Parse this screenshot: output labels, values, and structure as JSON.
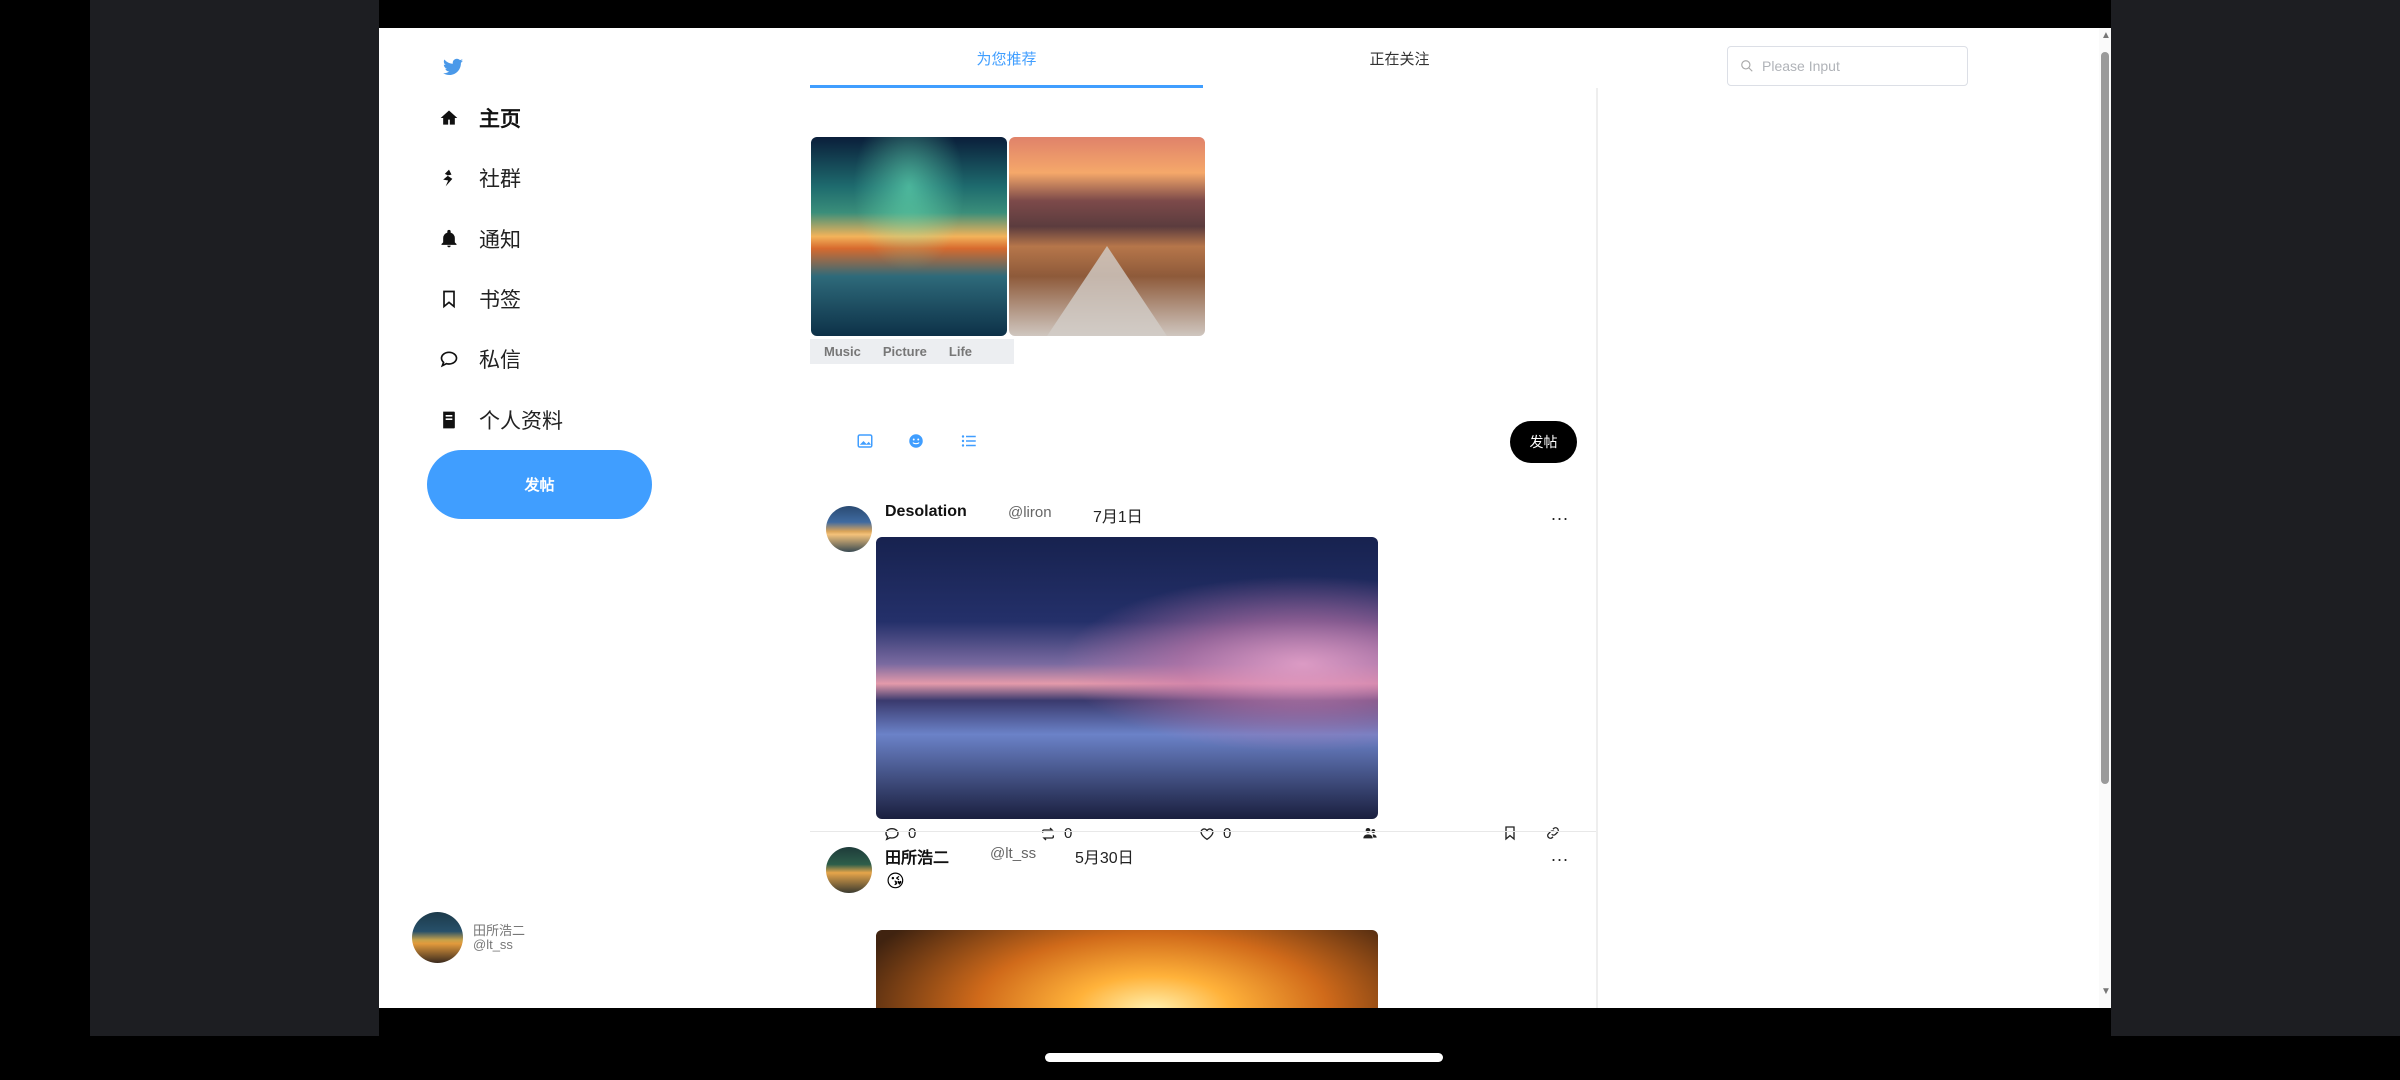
{
  "sidebar": {
    "logo": "twitter-icon",
    "items": [
      {
        "label": "主页",
        "icon": "home-icon"
      },
      {
        "label": "社群",
        "icon": "community-icon"
      },
      {
        "label": "通知",
        "icon": "bell-icon"
      },
      {
        "label": "书签",
        "icon": "bookmark-icon"
      },
      {
        "label": "私信",
        "icon": "message-icon"
      },
      {
        "label": "个人资料",
        "icon": "profile-book-icon"
      }
    ],
    "post_button": "发帖",
    "profile": {
      "name": "田所浩二",
      "handle": "@lt_ss"
    }
  },
  "tabs": [
    {
      "label": "为您推荐"
    },
    {
      "label": "正在关注"
    }
  ],
  "search": {
    "placeholder": "Please Input"
  },
  "composer": {
    "tags": [
      "Music",
      "Picture",
      "Life"
    ],
    "tools": [
      "image-icon",
      "emoji-icon",
      "list-icon"
    ],
    "post_button": "发帖"
  },
  "posts": [
    {
      "name": "Desolation",
      "handle": "@liron",
      "date": "7月1日",
      "more": "...",
      "comments": "0",
      "retweets": "0",
      "likes": "0"
    },
    {
      "name": "田所浩二",
      "handle": "@lt_ss",
      "date": "5月30日",
      "more": "...",
      "emoji": "😘"
    }
  ],
  "colors": {
    "accent": "#409eff",
    "black_button": "#000000"
  }
}
